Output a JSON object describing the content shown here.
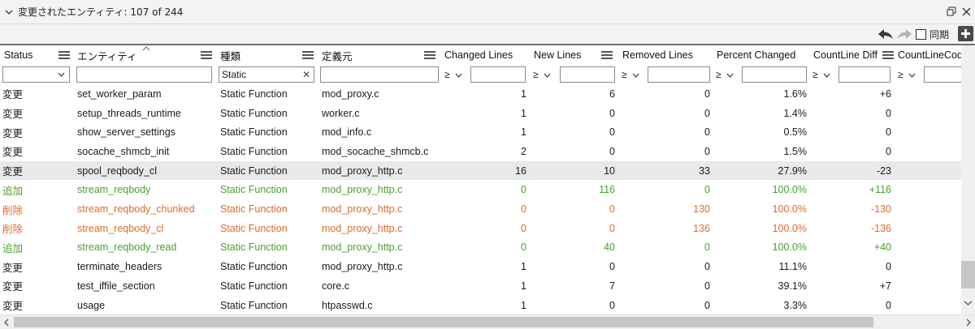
{
  "window": {
    "title": "変更されたエンティティ: 107 of 244",
    "restore_icon": "restore-window-icon",
    "close_icon": "close-icon"
  },
  "toolbar": {
    "sync_label": "同期",
    "sync_checked": false
  },
  "columns": [
    {
      "key": "status",
      "label": "Status"
    },
    {
      "key": "entity",
      "label": "エンティティ"
    },
    {
      "key": "kind",
      "label": "種類"
    },
    {
      "key": "defined_in",
      "label": "定義元"
    },
    {
      "key": "changed_lines",
      "label": "Changed Lines"
    },
    {
      "key": "new_lines",
      "label": "New Lines"
    },
    {
      "key": "removed_lines",
      "label": "Removed Lines"
    },
    {
      "key": "percent_changed",
      "label": "Percent Changed"
    },
    {
      "key": "countline_diff",
      "label": "CountLine Diff"
    },
    {
      "key": "countlinecode",
      "label": "CountLineCode"
    }
  ],
  "filters": {
    "kind_value": "Static",
    "op_symbol": "≥"
  },
  "colors": {
    "changed": "#1a1a1a",
    "added": "#4aa02c",
    "removed": "#e06a2c",
    "highlight_row": "#e9e9e9"
  },
  "rows": [
    {
      "status": "変更",
      "type": "changed",
      "entity": "set_worker_param",
      "kind": "Static Function",
      "defined_in": "mod_proxy.c",
      "changed_lines": "1",
      "new_lines": "6",
      "removed_lines": "0",
      "percent_changed": "1.6%",
      "countline_diff": "+6"
    },
    {
      "status": "変更",
      "type": "changed",
      "entity": "setup_threads_runtime",
      "kind": "Static Function",
      "defined_in": "worker.c",
      "changed_lines": "1",
      "new_lines": "0",
      "removed_lines": "0",
      "percent_changed": "1.4%",
      "countline_diff": "0"
    },
    {
      "status": "変更",
      "type": "changed",
      "entity": "show_server_settings",
      "kind": "Static Function",
      "defined_in": "mod_info.c",
      "changed_lines": "1",
      "new_lines": "0",
      "removed_lines": "0",
      "percent_changed": "0.5%",
      "countline_diff": "0"
    },
    {
      "status": "変更",
      "type": "changed",
      "entity": "socache_shmcb_init",
      "kind": "Static Function",
      "defined_in": "mod_socache_shmcb.c",
      "changed_lines": "2",
      "new_lines": "0",
      "removed_lines": "0",
      "percent_changed": "1.5%",
      "countline_diff": "0"
    },
    {
      "status": "変更",
      "type": "changed",
      "entity": "spool_reqbody_cl",
      "kind": "Static Function",
      "defined_in": "mod_proxy_http.c",
      "changed_lines": "16",
      "new_lines": "10",
      "removed_lines": "33",
      "percent_changed": "27.9%",
      "countline_diff": "-23",
      "highlight": true
    },
    {
      "status": "追加",
      "type": "added",
      "entity": "stream_reqbody",
      "kind": "Static Function",
      "defined_in": "mod_proxy_http.c",
      "changed_lines": "0",
      "new_lines": "116",
      "removed_lines": "0",
      "percent_changed": "100.0%",
      "countline_diff": "+116"
    },
    {
      "status": "削除",
      "type": "removed",
      "entity": "stream_reqbody_chunked",
      "kind": "Static Function",
      "defined_in": "mod_proxy_http.c",
      "changed_lines": "0",
      "new_lines": "0",
      "removed_lines": "130",
      "percent_changed": "100.0%",
      "countline_diff": "-130"
    },
    {
      "status": "削除",
      "type": "removed",
      "entity": "stream_reqbody_cl",
      "kind": "Static Function",
      "defined_in": "mod_proxy_http.c",
      "changed_lines": "0",
      "new_lines": "0",
      "removed_lines": "136",
      "percent_changed": "100.0%",
      "countline_diff": "-136"
    },
    {
      "status": "追加",
      "type": "added",
      "entity": "stream_reqbody_read",
      "kind": "Static Function",
      "defined_in": "mod_proxy_http.c",
      "changed_lines": "0",
      "new_lines": "40",
      "removed_lines": "0",
      "percent_changed": "100.0%",
      "countline_diff": "+40"
    },
    {
      "status": "変更",
      "type": "changed",
      "entity": "terminate_headers",
      "kind": "Static Function",
      "defined_in": "mod_proxy_http.c",
      "changed_lines": "1",
      "new_lines": "0",
      "removed_lines": "0",
      "percent_changed": "11.1%",
      "countline_diff": "0"
    },
    {
      "status": "変更",
      "type": "changed",
      "entity": "test_iffile_section",
      "kind": "Static Function",
      "defined_in": "core.c",
      "changed_lines": "1",
      "new_lines": "7",
      "removed_lines": "0",
      "percent_changed": "39.1%",
      "countline_diff": "+7"
    },
    {
      "status": "変更",
      "type": "changed",
      "entity": "usage",
      "kind": "Static Function",
      "defined_in": "htpasswd.c",
      "changed_lines": "1",
      "new_lines": "0",
      "removed_lines": "0",
      "percent_changed": "3.3%",
      "countline_diff": "0"
    }
  ]
}
